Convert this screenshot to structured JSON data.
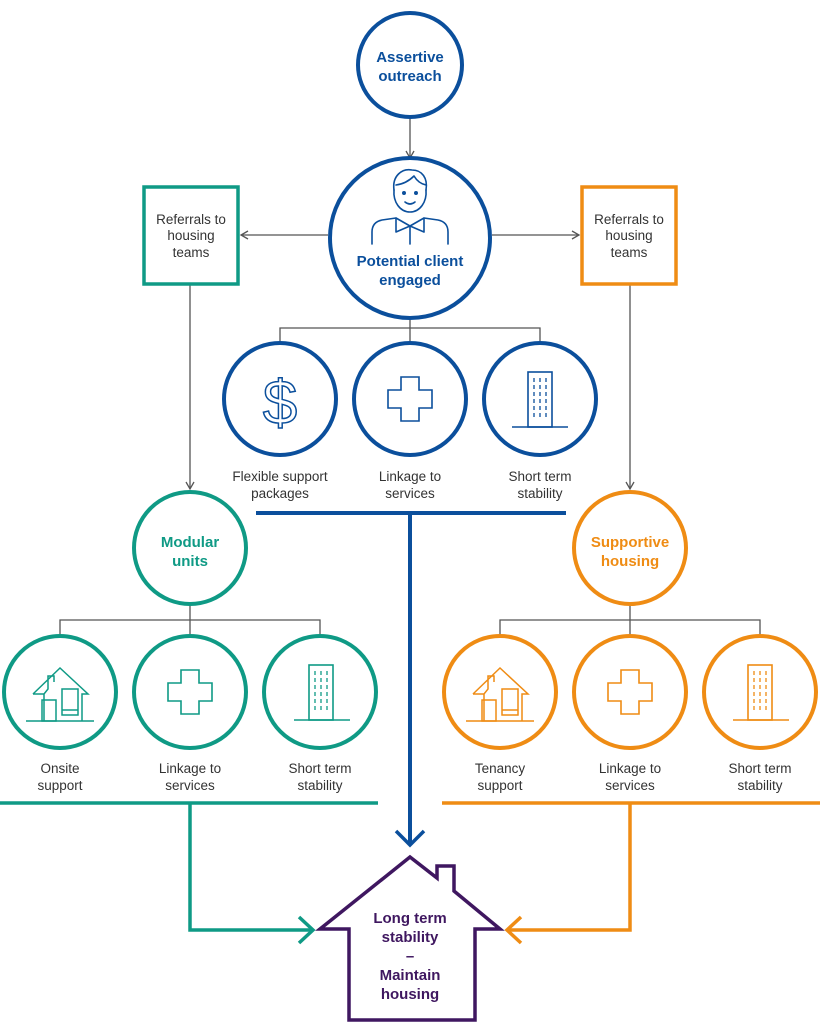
{
  "colors": {
    "blue": "#0b4f9c",
    "teal": "#0f9a85",
    "orange": "#ef8c14",
    "purple": "#3f1760",
    "connector": "#555555",
    "text": "#333333"
  },
  "top_node": {
    "label_lines": [
      "Assertive",
      "outreach"
    ]
  },
  "client_node": {
    "label_lines": [
      "Potential client",
      "engaged"
    ],
    "icon": "person-icon"
  },
  "referral_left": {
    "label_lines": [
      "Referrals to",
      "housing",
      "teams"
    ]
  },
  "referral_right": {
    "label_lines": [
      "Referrals to",
      "housing",
      "teams"
    ]
  },
  "center_services": [
    {
      "icon": "dollar-icon",
      "label_lines": [
        "Flexible support",
        "packages"
      ]
    },
    {
      "icon": "medical-cross-icon",
      "label_lines": [
        "Linkage to",
        "services"
      ]
    },
    {
      "icon": "building-icon",
      "label_lines": [
        "Short term",
        "stability"
      ]
    }
  ],
  "left_branch": {
    "title_lines": [
      "Modular",
      "units"
    ],
    "services": [
      {
        "icon": "house-icon",
        "label_lines": [
          "Onsite",
          "support"
        ]
      },
      {
        "icon": "medical-cross-icon",
        "label_lines": [
          "Linkage to",
          "services"
        ]
      },
      {
        "icon": "building-icon",
        "label_lines": [
          "Short term",
          "stability"
        ]
      }
    ]
  },
  "right_branch": {
    "title_lines": [
      "Supportive",
      "housing"
    ],
    "services": [
      {
        "icon": "house-icon",
        "label_lines": [
          "Tenancy",
          "support"
        ]
      },
      {
        "icon": "medical-cross-icon",
        "label_lines": [
          "Linkage to",
          "services"
        ]
      },
      {
        "icon": "building-icon",
        "label_lines": [
          "Short term",
          "stability"
        ]
      }
    ]
  },
  "outcome": {
    "label_lines": [
      "Long term",
      "stability",
      "–",
      "Maintain",
      "housing"
    ]
  }
}
